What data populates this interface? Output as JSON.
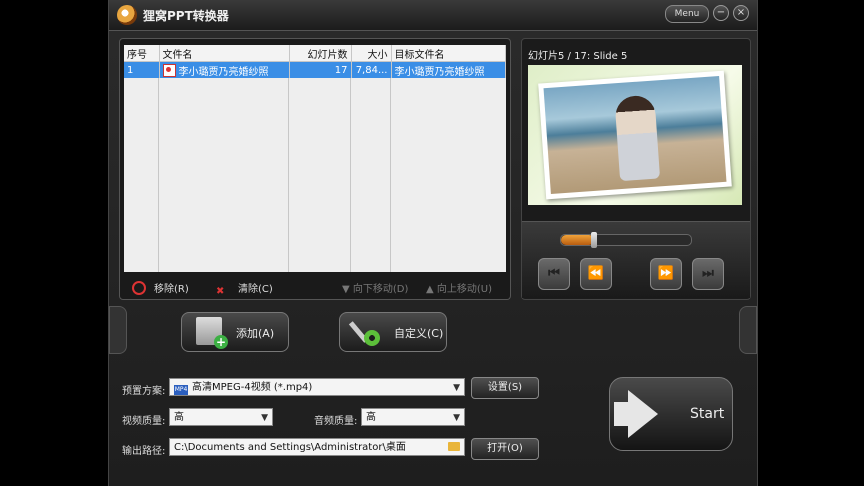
{
  "app": {
    "title": "狸窝PPT转换器",
    "menu_label": "Menu",
    "minimize": "−",
    "close": "×"
  },
  "file_list": {
    "columns": [
      "序号",
      "文件名",
      "幻灯片数",
      "大小",
      "目标文件名"
    ],
    "rows": [
      {
        "index": "1",
        "filename": "李小璐贾乃亮婚纱照",
        "slides": "17",
        "size": "7,84...",
        "target": "李小璐贾乃亮婚纱照"
      }
    ]
  },
  "list_toolbar": {
    "remove": "移除(R)",
    "clear": "清除(C)",
    "move_down": "向下移动(D)",
    "move_up": "向上移动(U)"
  },
  "preview": {
    "label": "幻灯片5 / 17: Slide 5",
    "progress_fraction": 0.25
  },
  "player": {
    "prev": "⏮",
    "rewind": "⏪",
    "forward": "⏩",
    "next": "⏭"
  },
  "buttons": {
    "add": "添加(A)",
    "custom": "自定义(C)",
    "settings": "设置(S)",
    "open": "打开(O)",
    "start": "Start"
  },
  "settings": {
    "preset_label": "预置方案:",
    "preset_value": "高清MPEG-4视频 (*.mp4)",
    "preset_icon_text": "MP4",
    "video_quality_label": "视频质量:",
    "video_quality_value": "高",
    "audio_quality_label": "音频质量:",
    "audio_quality_value": "高",
    "output_label": "输出路径:",
    "output_path": "C:\\Documents and Settings\\Administrator\\桌面"
  }
}
